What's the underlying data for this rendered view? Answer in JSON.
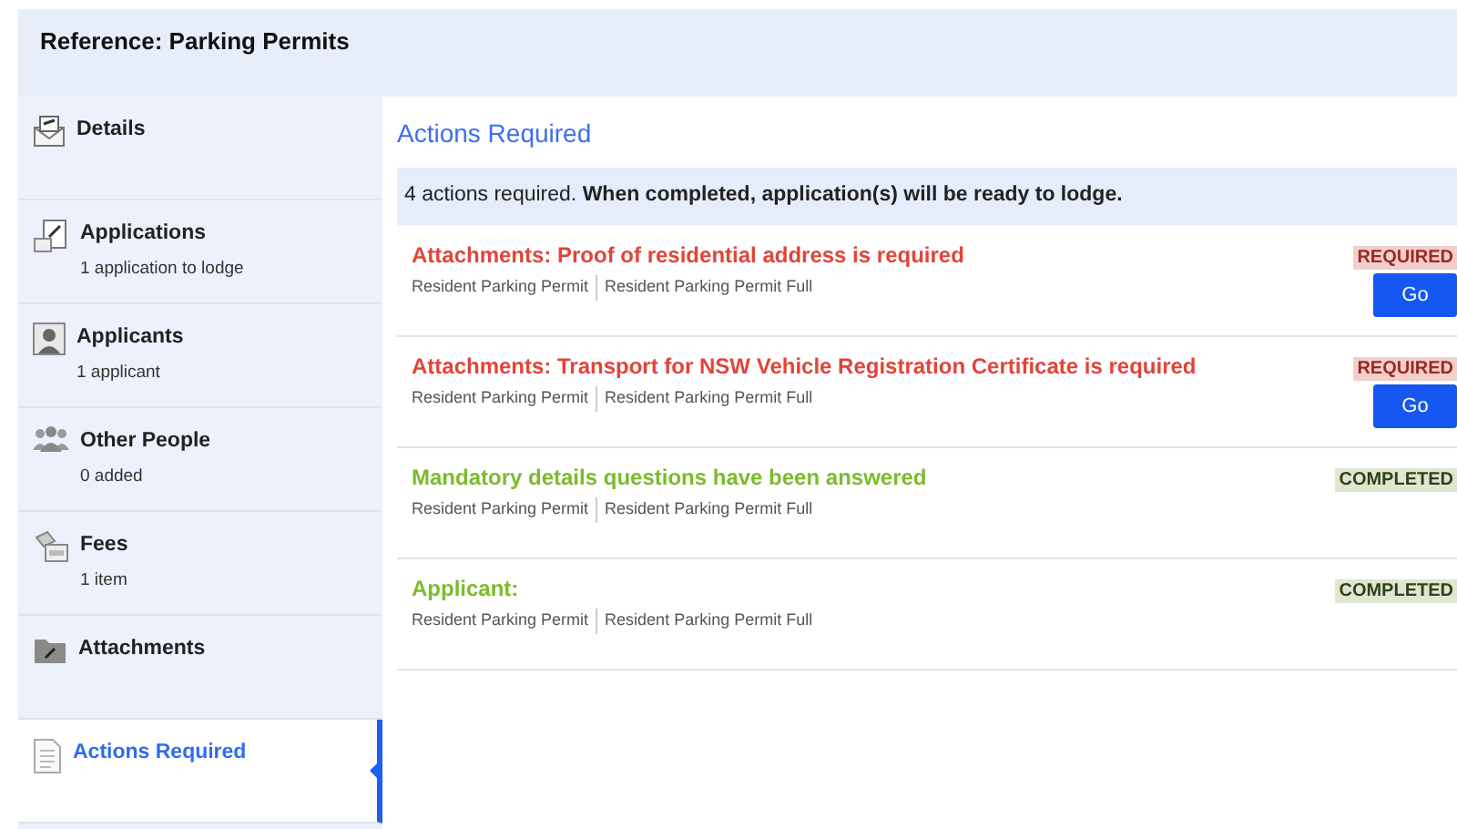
{
  "header": {
    "title": "Reference: Parking Permits"
  },
  "sidebar": {
    "items": [
      {
        "kind": "details",
        "label": "Details",
        "selected": false
      },
      {
        "kind": "applications",
        "label": "Applications",
        "subtitle": "1 application to lodge",
        "selected": false
      },
      {
        "kind": "applicants",
        "label": "Applicants",
        "subtitle": "1 applicant",
        "selected": false
      },
      {
        "kind": "people",
        "label": "Other People",
        "subtitle": "0 added",
        "selected": false
      },
      {
        "kind": "fees",
        "label": "Fees",
        "subtitle": "1 item",
        "selected": false
      },
      {
        "kind": "attachments",
        "label": "Attachments",
        "selected": false
      },
      {
        "kind": "actions",
        "label": "Actions Required",
        "selected": true
      }
    ]
  },
  "main": {
    "heading": "Actions Required",
    "summary": "4 actions required. **When completed, application(s) will be ready to lodge.**",
    "actions": [
      {
        "kind": "required",
        "title": "Attachments: Proof of residential address is required",
        "tags": [
          "Resident Parking Permit",
          "Resident Parking Permit Full"
        ],
        "badge": "REQUIRED",
        "button": "Go"
      },
      {
        "kind": "required",
        "title": "Attachments: Transport for NSW Vehicle Registration Certificate is required",
        "tags": [
          "Resident Parking Permit",
          "Resident Parking Permit Full"
        ],
        "badge": "REQUIRED",
        "button": "Go"
      },
      {
        "kind": "completed",
        "title": "Mandatory details questions have been answered",
        "tags": [
          "Resident Parking Permit",
          "Resident Parking Permit Full"
        ],
        "badge": "COMPLETED"
      },
      {
        "kind": "completed",
        "title": "Applicant:",
        "tags": [
          "Resident Parking Permit",
          "Resident Parking Permit Full"
        ],
        "badge": "COMPLETED"
      }
    ]
  }
}
